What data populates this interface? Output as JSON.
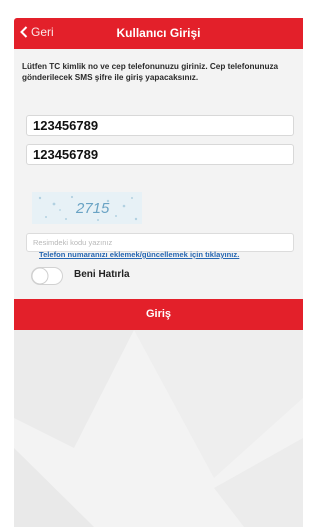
{
  "header": {
    "back_label": "Geri",
    "title": "Kullanıcı Girişi",
    "color": "#e3202a"
  },
  "instructions": "Lütfen TC kimlik no ve cep telefonunuzu giriniz. Cep telefonunuza gönderilecek SMS şifre ile giriş yapacaksınız.",
  "form": {
    "tc_value": "123456789",
    "phone_value": "123456789",
    "captcha_text": "2715",
    "captcha_placeholder": "Resimdeki kodu yazınız",
    "update_link": "Telefon numaranızı eklemek/güncellemek için tıklayınız.",
    "remember_label": "Beni Hatırla",
    "remember_on": false,
    "submit_label": "Giriş"
  }
}
